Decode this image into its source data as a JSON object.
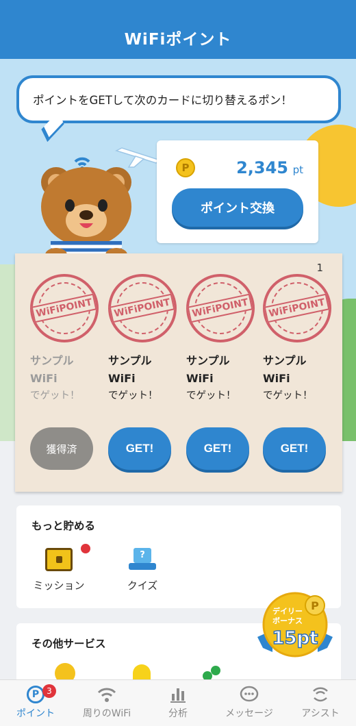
{
  "header": {
    "title": "WiFiポイント"
  },
  "bubble": {
    "text": "ポイントをGETして次のカードに切り替えるポン！"
  },
  "points": {
    "value": "2,345",
    "unit": "pt",
    "coin_glyph": "P",
    "exchange_label": "ポイント交換"
  },
  "card": {
    "number": "1",
    "stamp_text": "WiFiPOINT",
    "items": [
      {
        "title": "サンプル",
        "title2": "WiFi",
        "sub": "でゲット！",
        "button": "獲得済",
        "done": true
      },
      {
        "title": "サンプル",
        "title2": "WiFi",
        "sub": "でゲット！",
        "button": "GET!",
        "done": false
      },
      {
        "title": "サンプル",
        "title2": "WiFi",
        "sub": "でゲット！",
        "button": "GET!",
        "done": false
      },
      {
        "title": "サンプル",
        "title2": "WiFi",
        "sub": "でゲット！",
        "button": "GET!",
        "done": false
      }
    ]
  },
  "more_save": {
    "title": "もっと貯める",
    "items": [
      {
        "label": "ミッション",
        "icon": "treasure-chest-icon",
        "has_dot": true
      },
      {
        "label": "クイズ",
        "icon": "quiz-hat-icon",
        "glyph": "?"
      }
    ]
  },
  "other_services": {
    "title": "その他サービス"
  },
  "bonus": {
    "line1": "デイリー",
    "line2": "ボーナス",
    "amount": "15pt"
  },
  "tabs": [
    {
      "label": "ポイント",
      "icon": "points-icon",
      "active": true,
      "badge": "3"
    },
    {
      "label": "周りのWiFi",
      "icon": "wifi-icon"
    },
    {
      "label": "分析",
      "icon": "chart-icon"
    },
    {
      "label": "メッセージ",
      "icon": "message-icon"
    },
    {
      "label": "アシスト",
      "icon": "assist-icon"
    }
  ],
  "colors": {
    "brand_blue": "#2f86cf",
    "stamp_red": "#d0606a",
    "done_gray": "#8f8d89",
    "badge_red": "#e0343b"
  }
}
